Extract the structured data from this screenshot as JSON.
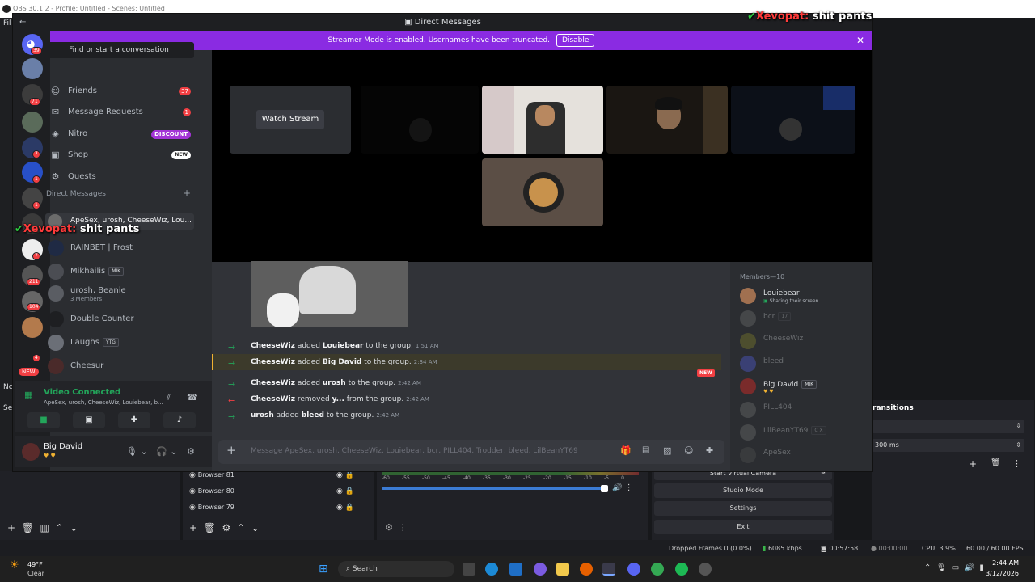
{
  "obs": {
    "title": "OBS 30.1.2 - Profile: Untitled - Scenes: Untitled",
    "menu_first": "Fil",
    "sources": [
      "Browser 81",
      "Browser 80",
      "Browser 79"
    ],
    "transitions_title": "ransitions",
    "duration": "300 ms",
    "controls": [
      "Start Virtual Camera",
      "Studio Mode",
      "Settings",
      "Exit"
    ],
    "status": {
      "dropped": "Dropped Frames 0 (0.0%)",
      "bitrate": "6085 kbps",
      "live_time": "00:57:58",
      "rec_time": "00:00:00",
      "cpu": "CPU: 3.9%",
      "fps": "60.00 / 60.00 FPS"
    },
    "left_edge_labels": [
      "Nc",
      "Se"
    ],
    "meter_ticks": [
      "-60",
      "-55",
      "-50",
      "-45",
      "-40",
      "-35",
      "-30",
      "-25",
      "-20",
      "-15",
      "-10",
      "-5",
      "0"
    ]
  },
  "overlay": {
    "name": "Xevopat:",
    "text": "shit pants"
  },
  "discord": {
    "window_title": "Direct Messages",
    "banner": {
      "text": "Streamer Mode is enabled. Usernames have been truncated.",
      "button": "Disable"
    },
    "search_placeholder": "Find or start a conversation",
    "nav": [
      {
        "label": "Friends",
        "badge": "37"
      },
      {
        "label": "Message Requests",
        "badge": "1"
      },
      {
        "label": "Nitro",
        "badge": "DISCOUNT"
      },
      {
        "label": "Shop",
        "badge": "NEW"
      },
      {
        "label": "Quests",
        "badge": ""
      }
    ],
    "dm_header": "Direct Messages",
    "dms": [
      {
        "name": "ApeSex, urosh, CheeseWiz, Lou...",
        "sub": ""
      },
      {
        "name": "RAINBET | Frost",
        "sub": ""
      },
      {
        "name": "Mikhailis",
        "tag": "MIK",
        "sub": ""
      },
      {
        "name": "urosh, Beanie",
        "sub": "3 Members"
      },
      {
        "name": "Double Counter",
        "sub": ""
      },
      {
        "name": "Laughs",
        "tag": "YTG",
        "sub": ""
      },
      {
        "name": "Cheesur",
        "sub": ""
      }
    ],
    "server_badges": [
      "39",
      "71",
      "7",
      "1",
      "1",
      "1",
      "7",
      "211",
      "104",
      "4",
      "NEW"
    ],
    "voice": {
      "status": "Video Connected",
      "channel": "ApeSex, urosh, CheeseWiz, Louiebear, b..."
    },
    "user": {
      "name": "Big David",
      "status": "♥ ♥"
    },
    "watch_stream": "Watch Stream",
    "messages": [
      {
        "actor": "CheeseWiz",
        "verb": "added",
        "target": "Louiebear",
        "tail": "to the group.",
        "time": "1:51 AM",
        "kind": "add"
      },
      {
        "actor": "CheeseWiz",
        "verb": "added",
        "target": "Big David",
        "tail": "to the group.",
        "time": "2:34 AM",
        "kind": "add"
      },
      {
        "actor": "CheeseWiz",
        "verb": "added",
        "target": "urosh",
        "tail": "to the group.",
        "time": "2:42 AM",
        "kind": "add"
      },
      {
        "actor": "CheeseWiz",
        "verb": "removed",
        "target": "y...",
        "tail": "from the group.",
        "time": "2:42 AM",
        "kind": "remove"
      },
      {
        "actor": "urosh",
        "verb": "added",
        "target": "bleed",
        "tail": "to the group.",
        "time": "2:42 AM",
        "kind": "add"
      }
    ],
    "new_badge": "NEW",
    "input_placeholder": "Message ApeSex, urosh, CheeseWiz, Louiebear, bcr, PILL404, Trodder, bleed, LilBeanYT69",
    "members_header": "Members—10",
    "members": [
      {
        "name": "Louiebear",
        "status": "Sharing their screen",
        "dim": false
      },
      {
        "name": "bcr",
        "status": "",
        "tag": "17",
        "dim": true
      },
      {
        "name": "CheeseWiz",
        "status": "",
        "dim": true
      },
      {
        "name": "bleed",
        "status": "",
        "dim": true
      },
      {
        "name": "Big David",
        "status": "",
        "tag": "MIK",
        "dim": false
      },
      {
        "name": "PILL404",
        "status": "",
        "dim": true
      },
      {
        "name": "LilBeanYT69",
        "status": "",
        "tag": "C X",
        "dim": true
      },
      {
        "name": "ApeSex",
        "status": "",
        "dim": true
      }
    ]
  },
  "taskbar": {
    "weather_temp": "49°F",
    "weather_text": "Clear",
    "search": "Search",
    "time": "2:44 AM",
    "date": "3/12/2026"
  }
}
